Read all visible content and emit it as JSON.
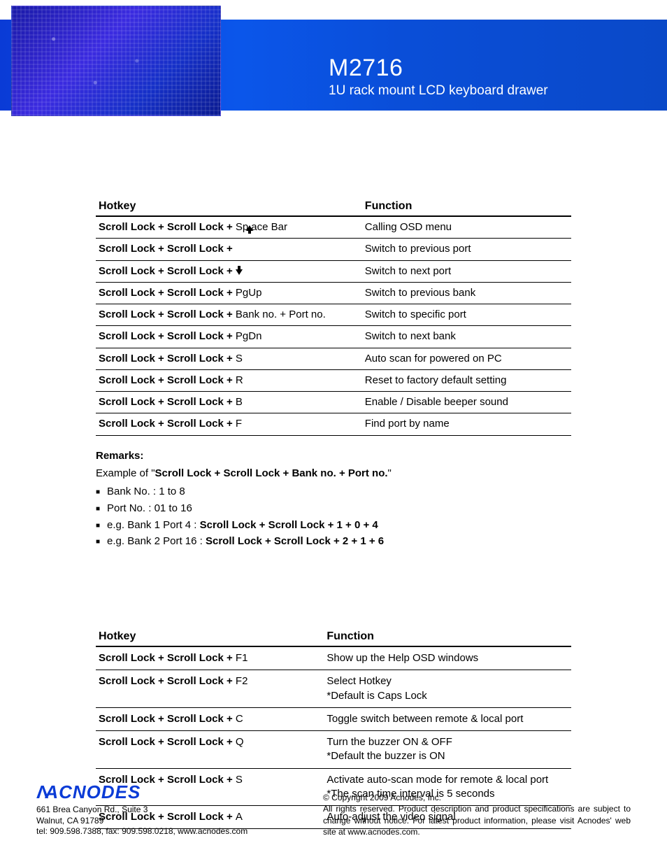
{
  "header": {
    "model": "M2716",
    "subtitle": "1U rack mount LCD keyboard drawer"
  },
  "table1": {
    "col_hotkey": "Hotkey",
    "col_function": "Function",
    "prefix": "Scroll Lock  +  Scroll Lock  +",
    "rows": [
      {
        "key": "Space Bar",
        "key_bold": false,
        "arrow": "up-inline",
        "fn": "Calling OSD menu"
      },
      {
        "key": "",
        "key_bold": false,
        "arrow": "",
        "fn": "Switch to previous port"
      },
      {
        "key": "",
        "key_bold": false,
        "arrow": "down",
        "fn": "Switch to next port"
      },
      {
        "key": "PgUp",
        "key_bold": false,
        "arrow": "",
        "fn": "Switch to previous bank"
      },
      {
        "key": "Bank no.  +  Port no.",
        "key_bold": false,
        "arrow": "",
        "fn": "Switch to specific port"
      },
      {
        "key": "PgDn",
        "key_bold": false,
        "arrow": "",
        "fn": "Switch to next bank"
      },
      {
        "key": "S",
        "key_bold": false,
        "arrow": "",
        "fn": "Auto scan for powered on PC"
      },
      {
        "key": "R",
        "key_bold": false,
        "arrow": "",
        "fn": "Reset to factory default setting"
      },
      {
        "key": "B",
        "key_bold": false,
        "arrow": "",
        "fn": "Enable / Disable beeper sound"
      },
      {
        "key": "F",
        "key_bold": false,
        "arrow": "",
        "fn": "Find port by name"
      }
    ]
  },
  "remarks": {
    "title": "Remarks:",
    "example_prefix": "Example of \"",
    "example_bold": "Scroll Lock  +  Scroll Lock  +   Bank no.  +  Port no.",
    "example_suffix": "\"",
    "items": [
      {
        "plain": "Bank No. :  1 to 8",
        "bold": ""
      },
      {
        "plain": "Port No. :  01 to 16",
        "bold": ""
      },
      {
        "plain": "e.g. Bank 1 Port 4 :  ",
        "bold": "Scroll Lock   +   Scroll Lock   +   1   +   0   +   4"
      },
      {
        "plain": "e.g. Bank 2 Port 16 :  ",
        "bold": "Scroll Lock   +   Scroll Lock   +   2   +   1   +   6"
      }
    ]
  },
  "table2": {
    "col_hotkey": "Hotkey",
    "col_function": "Function",
    "prefix": "Scroll Lock  +  Scroll Lock  +",
    "rows": [
      {
        "key": "F1",
        "fn": "Show up the Help OSD windows"
      },
      {
        "key": "F2",
        "fn": "Select Hotkey\n*Default is Caps Lock"
      },
      {
        "key": "C",
        "fn": "Toggle switch between remote & local port"
      },
      {
        "key": "Q",
        "fn": "Turn the buzzer ON & OFF\n*Default the buzzer is ON"
      },
      {
        "key": "S",
        "fn": "Activate auto-scan mode for remote & local port\n*The scan time interval is 5 seconds"
      },
      {
        "key": "A",
        "fn": "Auto-adjust the video signal"
      }
    ]
  },
  "footer": {
    "logo": "ACNODES",
    "addr1": "661 Brea Canyon Rd., Suite 3",
    "addr2": "Walnut, CA 91789",
    "addr3": "tel: 909.598.7388, fax: 909.598.0218, www.acnodes.com",
    "copy": "© Copyright 2009 Acnodes, Inc.",
    "legal": "All rights reserved. Product description and product specifications are subject to change without notice. For latest product information, please visit Acnodes' web site at www.acnodes.com."
  }
}
